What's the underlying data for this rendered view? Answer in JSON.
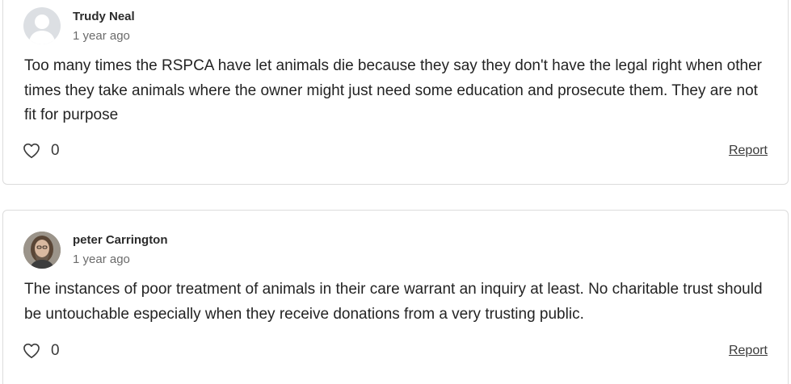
{
  "comments": [
    {
      "author": "Trudy Neal",
      "timestamp": "1 year ago",
      "avatar_icon": "default-user-silhouette-icon",
      "body": "Too many times the RSPCA have let animals die because they say they don't have the legal right when other times they take animals where the owner might just need some education and prosecute them. They are not fit for purpose",
      "likes": "0",
      "report_label": "Report"
    },
    {
      "author": "peter Carrington",
      "timestamp": "1 year ago",
      "avatar_icon": "user-photo-avatar",
      "body": "The instances of poor treatment of animals in their care warrant an inquiry at least. No charitable trust should be untouchable especially when they receive donations from a very trusting public.",
      "likes": "0",
      "report_label": "Report"
    }
  ],
  "colors": {
    "text": "#232323",
    "muted": "#6b6b6b",
    "border": "#dcdcdc",
    "avatar_placeholder": "#dcdfe3"
  }
}
